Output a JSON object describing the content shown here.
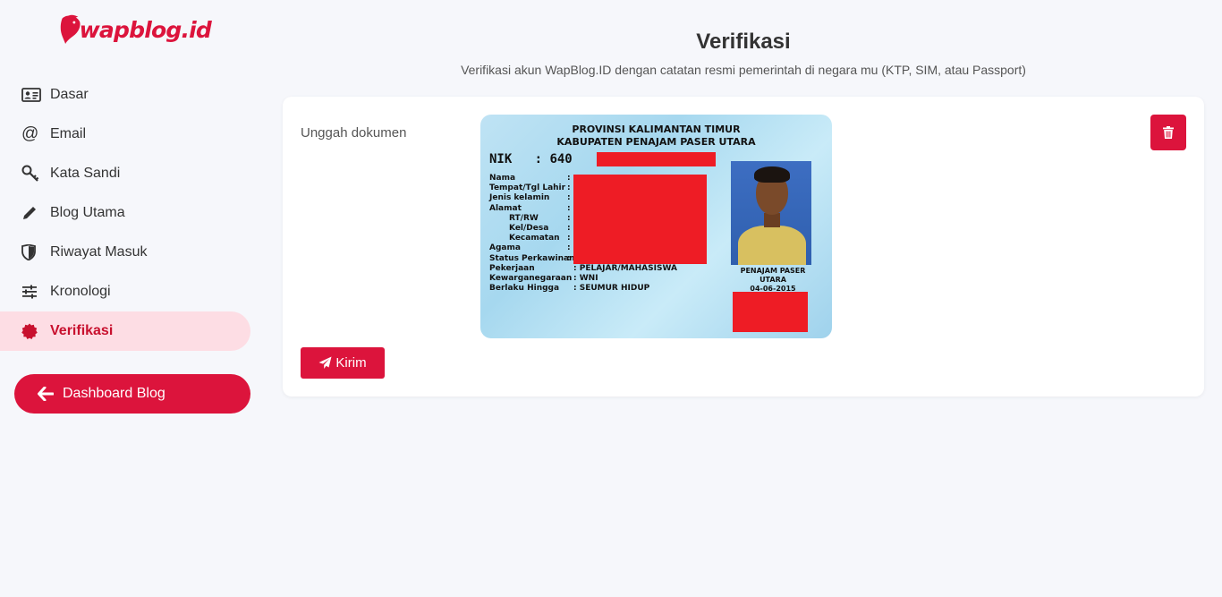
{
  "brand": {
    "logo_text": "wapblog.id",
    "accent": "#dc143c"
  },
  "sidebar": {
    "items": [
      {
        "label": "Dasar",
        "icon": "id-card-icon"
      },
      {
        "label": "Email",
        "icon": "at-icon"
      },
      {
        "label": "Kata Sandi",
        "icon": "key-icon"
      },
      {
        "label": "Blog Utama",
        "icon": "pencil-icon"
      },
      {
        "label": "Riwayat Masuk",
        "icon": "shield-icon"
      },
      {
        "label": "Kronologi",
        "icon": "sliders-icon"
      },
      {
        "label": "Verifikasi",
        "icon": "badge-icon",
        "active": true
      }
    ],
    "dashboard_button": "Dashboard Blog"
  },
  "header": {
    "title": "Verifikasi",
    "subtitle": "Verifikasi akun WapBlog.ID dengan catatan resmi pemerintah di negara mu (KTP, SIM, atau Passport)"
  },
  "form": {
    "upload_label": "Unggah dokumen",
    "send_button": "Kirim",
    "delete_icon": "trash-icon"
  },
  "id_card": {
    "province": "PROVINSI KALIMANTAN TIMUR",
    "regency": "KABUPATEN PENAJAM PASER UTARA",
    "nik_label": "NIK",
    "nik_value": ": 640",
    "fields": [
      "Nama",
      "Tempat/Tgl Lahir",
      "Jenis kelamin",
      "Alamat",
      "RT/RW",
      "Kel/Desa",
      "Kecamatan",
      "Agama",
      "Status Perkawinan",
      "Pekerjaan",
      "Kewarganegaraan",
      "Berlaku Hingga"
    ],
    "occupation": ": PELAJAR/MAHASISWA",
    "citizenship": ": WNI",
    "valid_until": ": SEUMUR HIDUP",
    "place_line1": "PENAJAM PASER",
    "place_line2": "UTARA",
    "issue_date": "04-06-2015"
  }
}
